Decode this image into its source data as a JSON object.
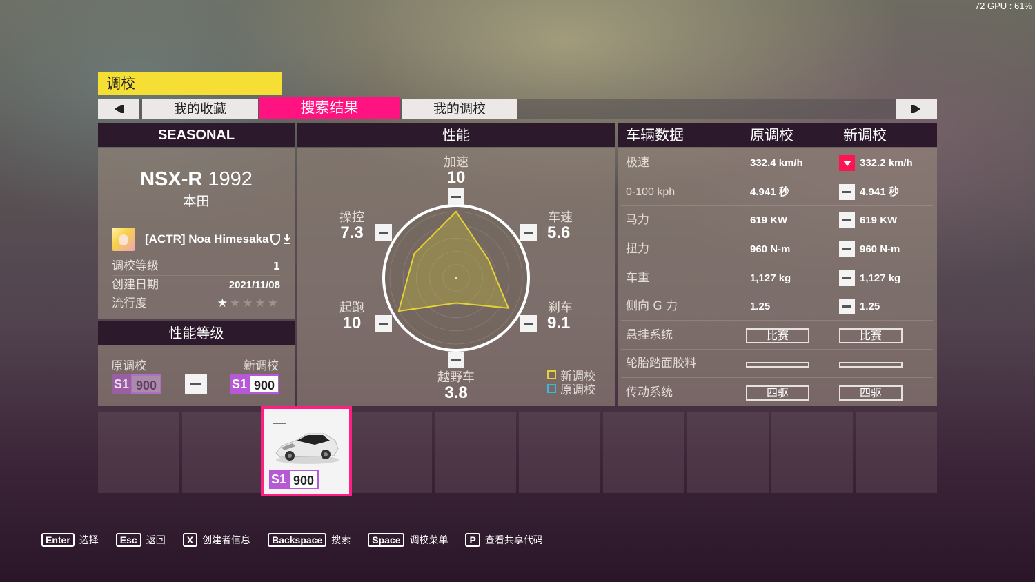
{
  "hud": {
    "text": "72 GPU : 61%"
  },
  "title": "调校",
  "tabs": [
    {
      "label": "我的收藏"
    },
    {
      "label": "搜索结果",
      "active": true
    },
    {
      "label": "我的调校"
    }
  ],
  "left_panel": {
    "header": "SEASONAL",
    "car_model": "NSX-R",
    "car_year": "1992",
    "car_make": "本田",
    "creator": "[ACTR] Noa Himesaka",
    "tune_level_label": "调校等级",
    "tune_level_value": "1",
    "created_label": "创建日期",
    "created_value": "2021/11/08",
    "popularity_label": "流行度",
    "popularity_stars": 1,
    "popularity_max": 5
  },
  "pi_panel": {
    "header": "性能等级",
    "original_label": "原调校",
    "new_label": "新调校",
    "original_class": "S1",
    "original_value": "900",
    "new_class": "S1",
    "new_value": "900"
  },
  "performance": {
    "header": "性能",
    "stats": {
      "accel": {
        "label": "加速",
        "value": "10"
      },
      "speed": {
        "label": "车速",
        "value": "5.6"
      },
      "braking": {
        "label": "刹车",
        "value": "9.1"
      },
      "offroad": {
        "label": "越野车",
        "value": "3.8"
      },
      "launch": {
        "label": "起跑",
        "value": "10"
      },
      "handling": {
        "label": "操控",
        "value": "7.3"
      }
    },
    "legend_new": "新调校",
    "legend_original": "原调校",
    "colors": {
      "new": "#e6d238",
      "original": "#3fb8d8"
    },
    "scale_max": 10
  },
  "vehicle_data": {
    "header": "车辆数据",
    "col_original": "原调校",
    "col_new": "新调校",
    "rows": [
      {
        "label": "极速",
        "original": "332.4 km/h",
        "new": "332.2 km/h",
        "change": "down"
      },
      {
        "label": "0-100 kph",
        "original": "4.941 秒",
        "new": "4.941 秒",
        "change": "same"
      },
      {
        "label": "马力",
        "original": "619 KW",
        "new": "619 KW",
        "change": "same"
      },
      {
        "label": "扭力",
        "original": "960 N-m",
        "new": "960 N-m",
        "change": "same"
      },
      {
        "label": "车重",
        "original": "1,127 kg",
        "new": "1,127 kg",
        "change": "same"
      },
      {
        "label": "侧向 G 力",
        "original": "1.25",
        "new": "1.25",
        "change": "same"
      },
      {
        "label": "悬挂系统",
        "original": "比赛",
        "new": "比赛",
        "change": "box"
      },
      {
        "label": "轮胎踏面胶料",
        "original": "",
        "new": "",
        "change": "box"
      },
      {
        "label": "传动系统",
        "original": "四驱",
        "new": "四驱",
        "change": "box"
      }
    ]
  },
  "car_card": {
    "class": "S1",
    "value": "900"
  },
  "footer": [
    {
      "key": "Enter",
      "action": "选择"
    },
    {
      "key": "Esc",
      "action": "返回"
    },
    {
      "key": "X",
      "action": "创建者信息"
    },
    {
      "key": "Backspace",
      "action": "搜索"
    },
    {
      "key": "Space",
      "action": "调校菜单"
    },
    {
      "key": "P",
      "action": "查看共享代码"
    }
  ]
}
